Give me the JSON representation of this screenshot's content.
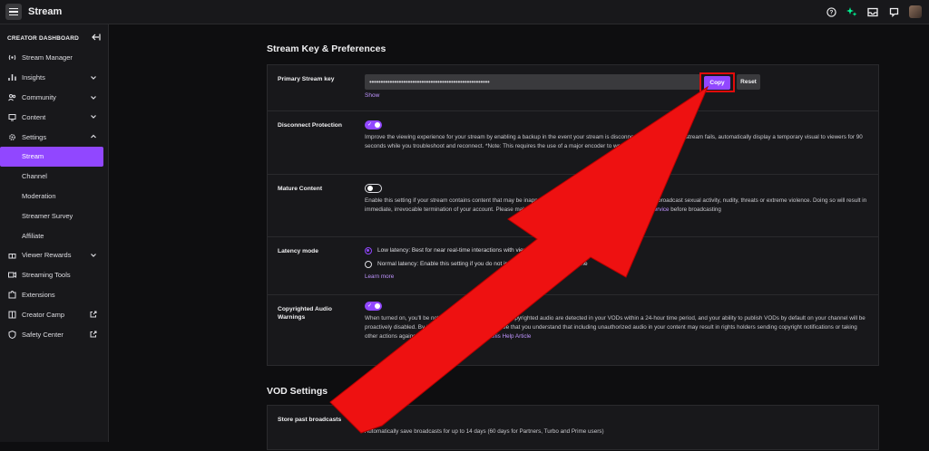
{
  "app": {
    "title": "Stream"
  },
  "sidebar": {
    "header": "CREATOR DASHBOARD",
    "items": [
      {
        "label": "Stream Manager",
        "icon": "broadcast-icon",
        "chevron": false
      },
      {
        "label": "Insights",
        "icon": "bar-chart-icon",
        "chevron": true
      },
      {
        "label": "Community",
        "icon": "community-icon",
        "chevron": true
      },
      {
        "label": "Content",
        "icon": "content-icon",
        "chevron": true
      },
      {
        "label": "Settings",
        "icon": "gear-icon",
        "chevron": true,
        "expanded": true
      }
    ],
    "settings_sub": [
      "Stream",
      "Channel",
      "Moderation",
      "Streamer Survey",
      "Affiliate"
    ],
    "items_after": [
      {
        "label": "Viewer Rewards",
        "icon": "gift-icon",
        "chevron": true
      },
      {
        "label": "Streaming Tools",
        "icon": "camera-icon",
        "chevron": false
      },
      {
        "label": "Extensions",
        "icon": "puzzle-icon",
        "chevron": false
      },
      {
        "label": "Creator Camp",
        "icon": "book-icon",
        "external": true
      },
      {
        "label": "Safety Center",
        "icon": "shield-icon",
        "external": true
      }
    ]
  },
  "stream_key": {
    "section_title": "Stream Key & Preferences",
    "primary_label": "Primary Stream key",
    "key_masked": "•••••••••••••••••••••••••••••••••••••••••••••••••••••",
    "copy_label": "Copy",
    "reset_label": "Reset",
    "show_label": "Show",
    "disconnect": {
      "label": "Disconnect Protection",
      "toggle": true,
      "text": "Improve the viewing experience for your stream by enabling a backup in the event your stream is disconnected. If your primary stream fails, automatically display a temporary visual to viewers for 90 seconds while you troubleshoot and reconnect. *Note: This requires the use of a major encoder to work properly."
    },
    "mature": {
      "label": "Mature Content",
      "toggle": false,
      "text_pre": "Enable this setting if your stream contains content that may be inappropriate for younger audiences. You may never broadcast sexual activity, nudity, threats or extreme violence. Doing so will result in immediate, irrevocable termination of your account. Please make sure your content will comply with the ",
      "tos_link": "Terms of Service",
      "text_post": " before broadcasting"
    },
    "latency": {
      "label": "Latency mode",
      "low": "Low latency: Best for near real-time interactions with viewers",
      "normal": "Normal latency: Enable this setting if you do not interact with viewers in real-time",
      "learn_more": "Learn more",
      "selected": "low"
    },
    "copyright": {
      "label": "Copyrighted Audio Warnings",
      "toggle": true,
      "text": "When turned on, you'll be notified if multiple instances of copyrighted audio are detected in your VODs within a 24-hour time period, and your ability to publish VODs by default on your channel will be proactively disabled. By turning this setting off, you agree that you understand that including unauthorized audio in your content may result in rights holders sending copyright notifications or taking other actions against your channel. Learn more ",
      "help_link": "in this Help Article"
    }
  },
  "vod": {
    "section_title": "VOD Settings",
    "store_label": "Store past broadcasts",
    "toggle": true,
    "text": "Automatically save broadcasts for up to 14 days (60 days for Partners, Turbo and Prime users)"
  },
  "colors": {
    "accent": "#9147ff",
    "annotation_red": "#e10b0b",
    "link": "#bf94ff"
  }
}
